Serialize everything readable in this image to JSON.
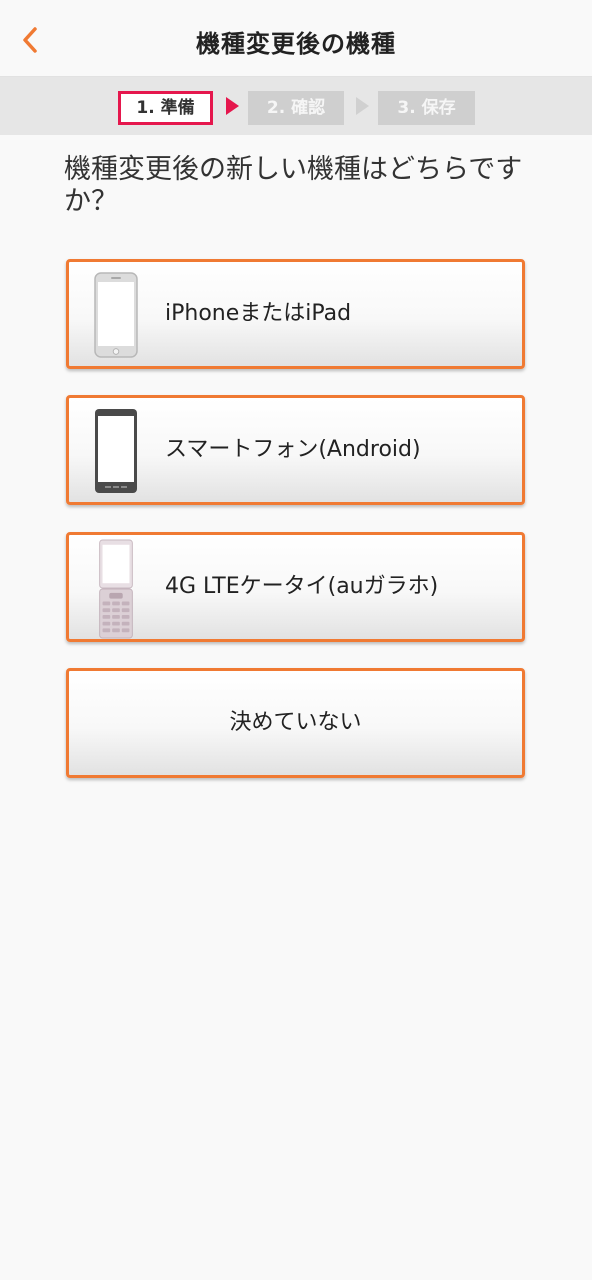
{
  "header": {
    "title": "機種変更後の機種",
    "back_icon": "chevron-left-icon",
    "accent_color": "#f07a33"
  },
  "steps": [
    {
      "label": "1. 準備",
      "state": "active"
    },
    {
      "label": "2. 確認",
      "state": "inactive"
    },
    {
      "label": "3. 保存",
      "state": "inactive"
    }
  ],
  "question": "機種変更後の新しい機種はどちらですか？",
  "options": [
    {
      "label": "iPhoneまたはiPad",
      "icon": "iphone-icon"
    },
    {
      "label": "スマートフォン(Android)",
      "icon": "android-phone-icon"
    },
    {
      "label": "4G LTEケータイ(auガラホ)",
      "icon": "flip-phone-icon"
    },
    {
      "label": "決めていない"
    }
  ],
  "colors": {
    "active_step_border": "#e5174d",
    "option_border": "#f07a33",
    "inactive_step": "#cfcfcf"
  }
}
